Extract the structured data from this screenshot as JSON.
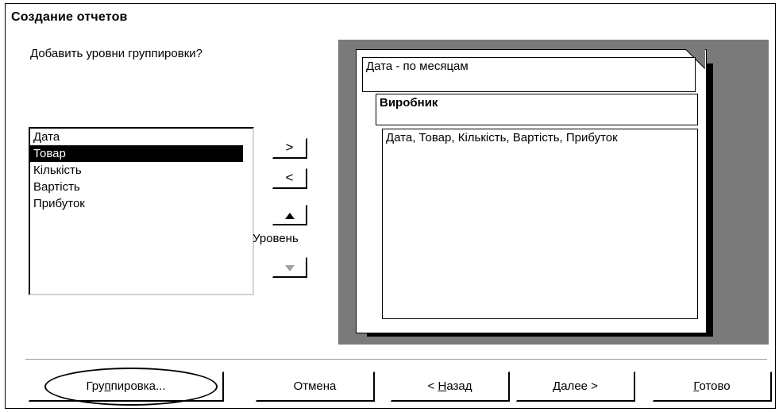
{
  "window": {
    "title": "Создание отчетов"
  },
  "prompt": "Добавить уровни группировки?",
  "fields": {
    "items": [
      "Дата",
      "Товар",
      "Кількість",
      "Вартість",
      "Прибуток"
    ],
    "selected": "Товар"
  },
  "side_buttons": {
    "add": ">",
    "remove": "<",
    "up_icon": "arrow-up-icon",
    "down_icon": "arrow-down-icon",
    "level_label": "Уровень"
  },
  "preview": {
    "level1": "Дата - по месяцам",
    "level2": "Виробник",
    "detail": "Дата, Товар, Кількість, Вартість, Прибуток"
  },
  "buttons": {
    "grouping": {
      "pre": "Гру",
      "accel": "п",
      "post": "пировка..."
    },
    "cancel": "Отмена",
    "back": {
      "pre": "< ",
      "accel": "Н",
      "post": "азад"
    },
    "next": {
      "pre": "",
      "accel": "Д",
      "post": "алее >"
    },
    "finish": {
      "pre": "",
      "accel": "Г",
      "post": "отово"
    }
  }
}
